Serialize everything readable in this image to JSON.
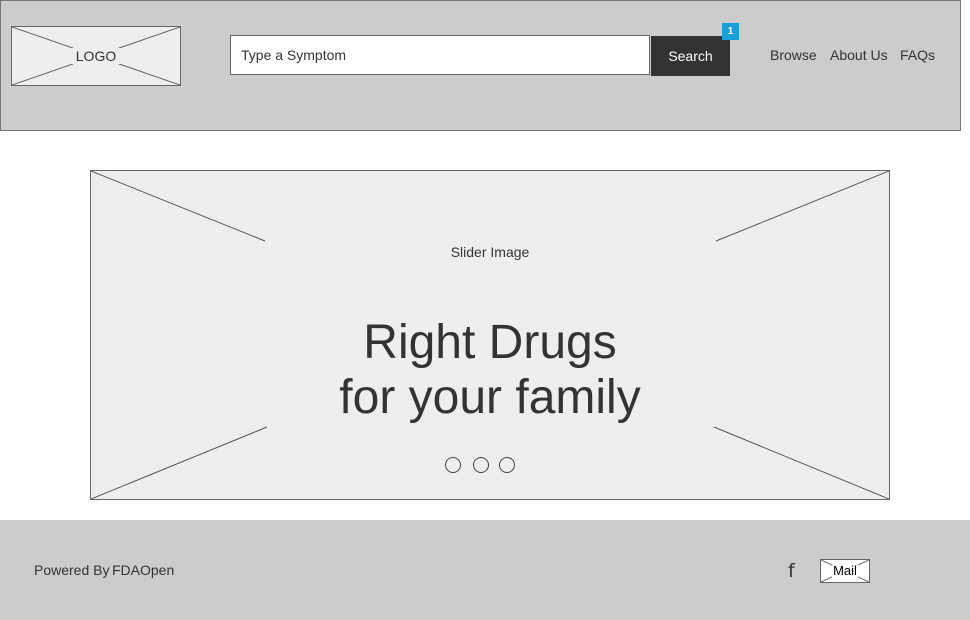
{
  "header": {
    "logo_label": "LOGO",
    "search": {
      "placeholder": "Type a Symptom",
      "button_label": "Search",
      "badge": "1"
    },
    "nav": [
      {
        "label": "Browse"
      },
      {
        "label": "About Us"
      },
      {
        "label": "FAQs"
      }
    ]
  },
  "hero": {
    "caption": "Slider Image",
    "title_line1": "Right Drugs",
    "title_line2": "for your family",
    "dots": 3
  },
  "footer": {
    "powered_by": "Powered By",
    "brand": "FDAOpen",
    "facebook_glyph": "f",
    "mail_label": "Mail"
  }
}
